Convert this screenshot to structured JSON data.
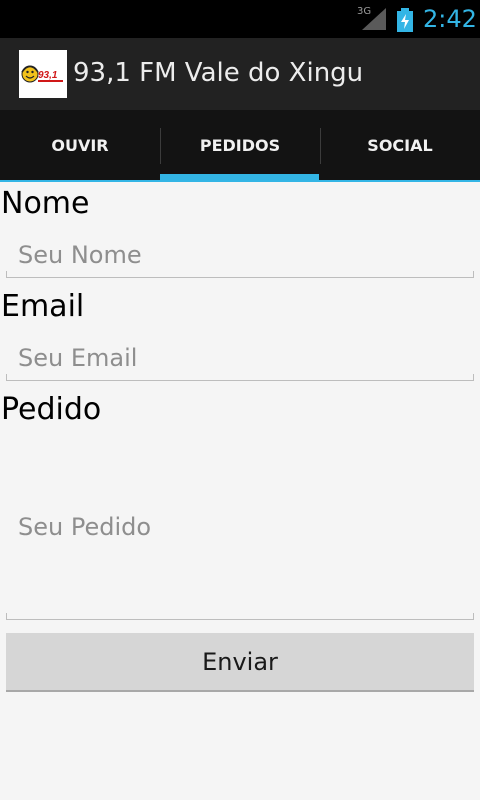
{
  "status_bar": {
    "network": "3G",
    "time": "2:42"
  },
  "action_bar": {
    "title": "93,1 FM Vale do Xingu",
    "logo_text": "93,1"
  },
  "tabs": [
    {
      "label": "OUVIR",
      "active": false
    },
    {
      "label": "PEDIDOS",
      "active": true
    },
    {
      "label": "SOCIAL",
      "active": false
    }
  ],
  "form": {
    "name_label": "Nome",
    "name_placeholder": "Seu Nome",
    "email_label": "Email",
    "email_placeholder": "Seu Email",
    "request_label": "Pedido",
    "request_placeholder": "Seu Pedido",
    "submit_label": "Enviar"
  },
  "colors": {
    "accent": "#33b5e5",
    "action_bar": "#222222",
    "tab_bar": "#131313",
    "status_bar": "#000000",
    "background": "#f5f5f5"
  }
}
